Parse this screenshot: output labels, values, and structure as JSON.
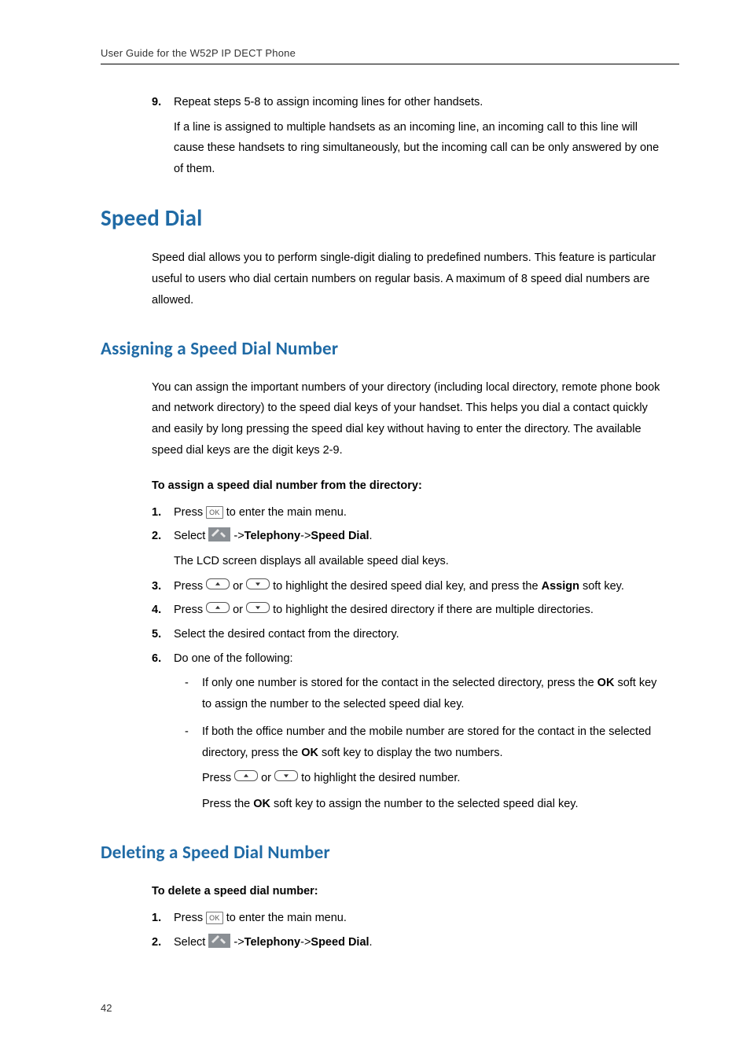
{
  "header": {
    "running": "User Guide for the W52P IP DECT Phone"
  },
  "page_number": "42",
  "continued": {
    "num": "9.",
    "text": "Repeat steps 5-8 to assign incoming lines for other handsets.",
    "note": "If a line is assigned to multiple handsets as an incoming line, an incoming call to this line will cause these handsets to ring simultaneously, but the incoming call can be only answered by one of them."
  },
  "sections": {
    "speed_dial": {
      "title": "Speed Dial",
      "intro": "Speed dial allows you to perform single-digit dialing to predefined numbers. This feature is particular useful to users who dial certain numbers on regular basis. A maximum of 8 speed dial numbers are allowed."
    },
    "assigning": {
      "title": "Assigning a Speed Dial Number",
      "intro": "You can assign the important numbers of your directory (including local directory, remote phone book and network directory) to the speed dial keys of your handset. This helps you dial a contact quickly and easily by long pressing the speed dial key without having to enter the directory. The available speed dial keys are the digit keys 2-9.",
      "lead": "To assign a speed dial number from the directory:",
      "steps": [
        {
          "num": "1.",
          "pre": "Press ",
          "post": " to enter the main menu."
        },
        {
          "num": "2.",
          "pre": "Select ",
          "mid1": " ->",
          "b1": "Telephony",
          "mid2": "->",
          "b2": "Speed Dial",
          "post": ".",
          "sub": "The LCD screen displays all available speed dial keys."
        },
        {
          "num": "3.",
          "pre": "Press ",
          "orword": " or ",
          "mid": " to highlight the desired speed dial key, and press the ",
          "assign": "Assign",
          "post": " soft key."
        },
        {
          "num": "4.",
          "pre": "Press ",
          "orword": " or ",
          "post": " to highlight the desired directory if there are multiple directories."
        },
        {
          "num": "5.",
          "text": "Select the desired contact from the directory."
        },
        {
          "num": "6.",
          "text": "Do one of the following:",
          "bullets": [
            {
              "pre": "If only one number is stored for the contact in the selected directory, press the ",
              "ok": "OK",
              "post": " soft key to assign the number to the selected speed dial key."
            },
            {
              "pre": "If both the office number and the mobile number are stored for the contact in the selected directory, press the ",
              "ok": "OK",
              "post": " soft key to display the two numbers.",
              "line2_pre": "Press ",
              "line2_or": " or ",
              "line2_post": " to highlight the desired number.",
              "line3_pre": "Press the ",
              "line3_ok": "OK",
              "line3_post": " soft key to assign the number to the selected speed dial key."
            }
          ]
        }
      ]
    },
    "deleting": {
      "title": "Deleting a Speed Dial Number",
      "lead": "To delete a speed dial number:",
      "steps": [
        {
          "num": "1.",
          "pre": "Press ",
          "post": " to enter the main menu."
        },
        {
          "num": "2.",
          "pre": "Select ",
          "mid1": " ->",
          "b1": "Telephony",
          "mid2": "->",
          "b2": "Speed Dial",
          "post": "."
        }
      ]
    }
  },
  "labels": {
    "ok_key": "OK"
  }
}
